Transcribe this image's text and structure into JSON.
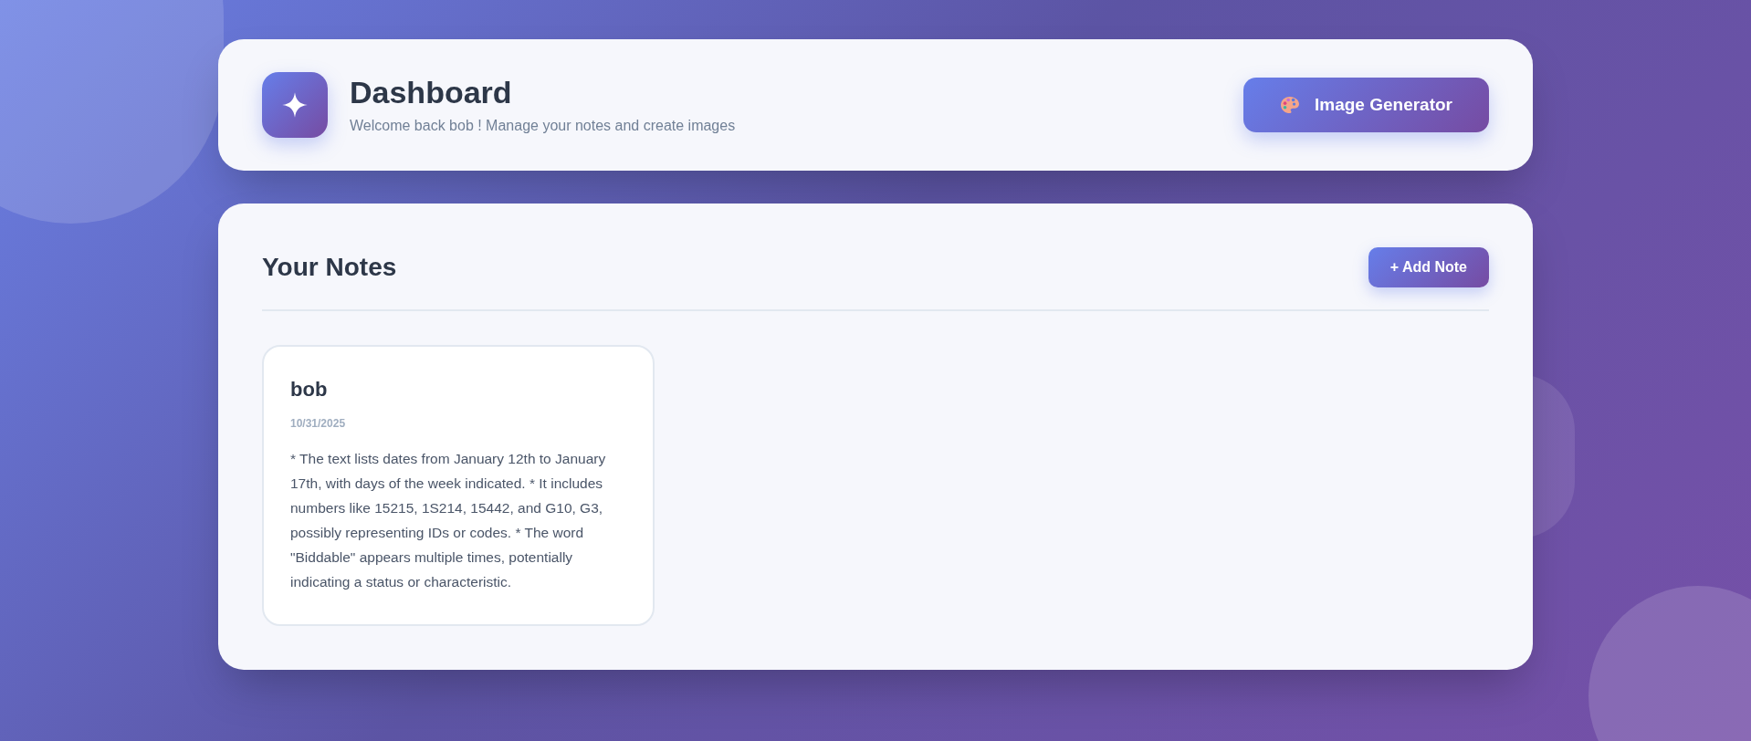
{
  "header": {
    "title": "Dashboard",
    "subtitle": "Welcome back bob ! Manage your notes and create images",
    "button": "Image Generator"
  },
  "notes_panel": {
    "title": "Your Notes",
    "add_button": "+ Add Note",
    "notes": [
      {
        "title": "bob",
        "date": "10/31/2025",
        "body": "* The text lists dates from January 12th to January 17th, with days of the week indicated. * It includes numbers like 15215, 1S214, 15442, and G10, G3, possibly representing IDs or codes. * The word \"Biddable\" appears multiple times, potentially indicating a status or characteristic."
      }
    ]
  }
}
